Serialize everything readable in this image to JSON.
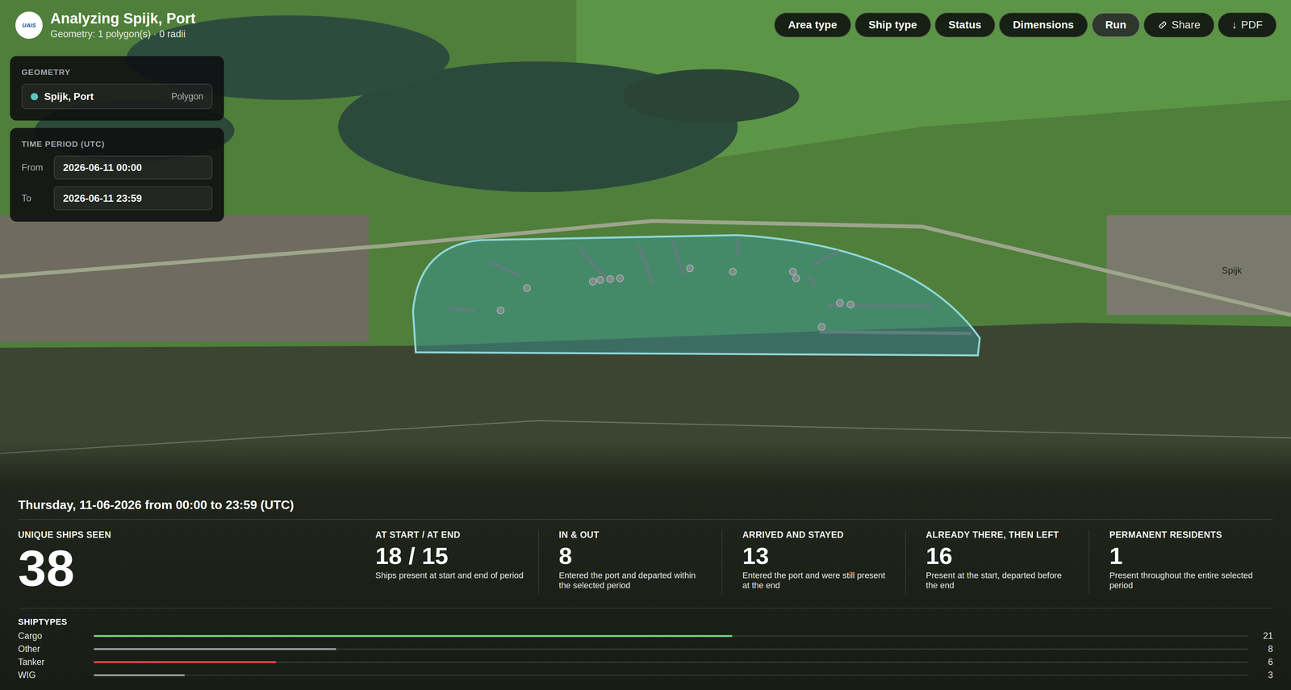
{
  "app": {
    "logo": "UAIS",
    "title": "Analyzing Spijk, Port",
    "subtitle": "Geometry: 1 polygon(s) · 0 radii"
  },
  "toolbar": [
    {
      "label": "Area type",
      "kind": "filter",
      "glyph": ""
    },
    {
      "label": "Ship type",
      "kind": "filter",
      "glyph": ""
    },
    {
      "label": "Status",
      "kind": "filter",
      "glyph": ""
    },
    {
      "label": "Dimensions",
      "kind": "filter",
      "glyph": ""
    },
    {
      "label": "Run",
      "kind": "run",
      "glyph": ""
    },
    {
      "label": "Share",
      "kind": "share",
      "glyph": ""
    },
    {
      "label": "PDF",
      "kind": "download",
      "glyph": "↓"
    }
  ],
  "geometry": {
    "heading": "GEOMETRY",
    "items": [
      {
        "name": "Spijk, Port",
        "type": "Polygon",
        "color": "#5cc4c4"
      }
    ]
  },
  "time_period": {
    "heading": "TIME PERIOD (UTC)",
    "fields": [
      {
        "label": "From",
        "value": "2026-06-11 00:00"
      },
      {
        "label": "To",
        "value": "2026-06-11 23:59"
      }
    ]
  },
  "map": {
    "labels": [
      {
        "text": "Spijk"
      }
    ]
  },
  "summary": {
    "heading": "Thursday, 11-06-2026 from 00:00 to 23:59 (UTC)",
    "stats": [
      {
        "label": "UNIQUE SHIPS SEEN",
        "value": "38",
        "description": "",
        "kind": "primary"
      },
      {
        "label": "AT START / AT END",
        "value": "18 / 15",
        "description": "Ships present at start and end of period",
        "kind": "secondary"
      },
      {
        "label": "IN & OUT",
        "value": "8",
        "description": "Entered the port and departed within the selected period",
        "kind": "secondary"
      },
      {
        "label": "ARRIVED AND STAYED",
        "value": "13",
        "description": "Entered the port and were still present at the end",
        "kind": "secondary"
      },
      {
        "label": "ALREADY THERE, THEN LEFT",
        "value": "16",
        "description": "Present at the start, departed before the end",
        "kind": "secondary"
      },
      {
        "label": "PERMANENT RESIDENTS",
        "value": "1",
        "description": "Present throughout the entire selected period",
        "kind": "secondary"
      }
    ]
  },
  "shiptypes": {
    "heading": "SHIPTYPES",
    "items": [
      {
        "name": "Cargo",
        "count": "21",
        "level": 0.553,
        "color": "#6fd07f"
      },
      {
        "name": "Other",
        "count": "8",
        "level": 0.21,
        "color": "#9a9a9a"
      },
      {
        "name": "Tanker",
        "count": "6",
        "level": 0.158,
        "color": "#e0484b"
      },
      {
        "name": "WIG",
        "count": "3",
        "level": 0.079,
        "color": "#9a9a9a"
      }
    ]
  }
}
